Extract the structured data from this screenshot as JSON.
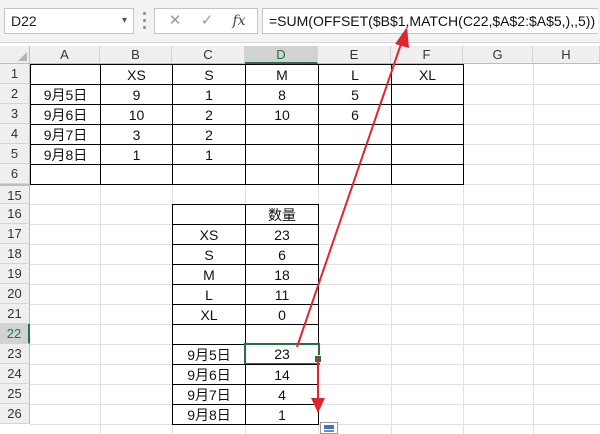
{
  "formula_bar": {
    "name_box": "D22",
    "dropdown_icon": "▾",
    "cancel_icon": "✕",
    "confirm_icon": "✓",
    "fx_label": "fx",
    "formula": "=SUM(OFFSET($B$1,MATCH(C22,$A$2:$A$5,),,5))"
  },
  "columns": [
    "A",
    "B",
    "C",
    "D",
    "E",
    "F",
    "G",
    "H"
  ],
  "rows": [
    "1",
    "2",
    "3",
    "4",
    "5",
    "6",
    "15",
    "16",
    "17",
    "18",
    "19",
    "20",
    "21",
    "22",
    "23",
    "24",
    "25",
    "26"
  ],
  "table1": {
    "header": [
      "",
      "XS",
      "S",
      "M",
      "L",
      "XL"
    ],
    "rows": [
      [
        "9月5日",
        "9",
        "1",
        "8",
        "5",
        ""
      ],
      [
        "9月6日",
        "10",
        "2",
        "10",
        "6",
        ""
      ],
      [
        "9月7日",
        "3",
        "2",
        "",
        "",
        ""
      ],
      [
        "9月8日",
        "1",
        "1",
        "",
        "",
        ""
      ],
      [
        "",
        "",
        "",
        "",
        "",
        ""
      ]
    ]
  },
  "table2": {
    "header": [
      "",
      "数量"
    ],
    "rows": [
      [
        "XS",
        "23"
      ],
      [
        "S",
        "6"
      ],
      [
        "M",
        "18"
      ],
      [
        "L",
        "11"
      ],
      [
        "XL",
        "0"
      ],
      [
        "",
        ""
      ]
    ]
  },
  "table3": {
    "rows": [
      [
        "9月5日",
        "23"
      ],
      [
        "9月6日",
        "14"
      ],
      [
        "9月7日",
        "4"
      ],
      [
        "9月8日",
        "1"
      ]
    ]
  },
  "colors": {
    "selection": "#217346",
    "arrow": "#e0262d",
    "header_bg": "#efefef"
  }
}
